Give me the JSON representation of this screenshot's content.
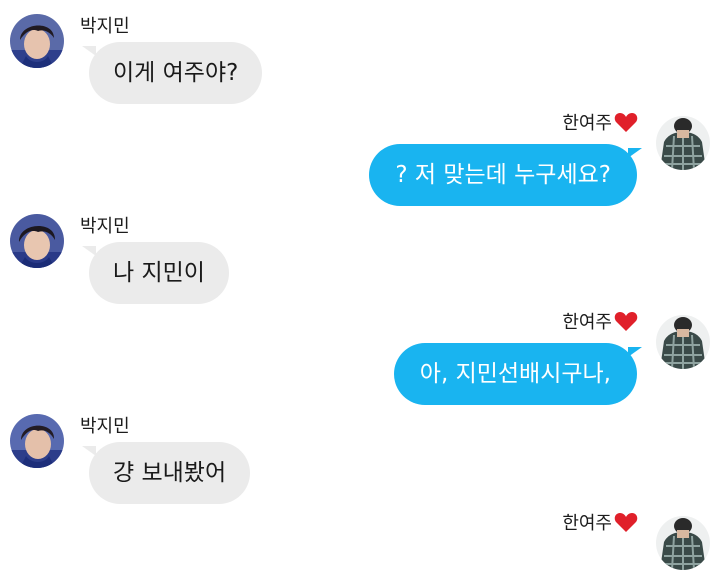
{
  "participants": {
    "them": {
      "name": "박지민",
      "avatar_icon": "profile-photo-jimin"
    },
    "me": {
      "name": "한여주",
      "name_icon": "red-heart-icon",
      "avatar_icon": "profile-photo-plaid-shirt"
    }
  },
  "colors": {
    "incoming_bubble": "#ebebeb",
    "outgoing_bubble": "#19b4f0",
    "heart": "#e0202a"
  },
  "messages": [
    {
      "sender": "박지민",
      "text": "이게 여주야?"
    },
    {
      "sender": "한여주",
      "text": "? 저 맞는데 누구세요?"
    },
    {
      "sender": "박지민",
      "text": "나 지민이"
    },
    {
      "sender": "한여주",
      "text": "아, 지민선배시구나,"
    },
    {
      "sender": "박지민",
      "text": "걍 보내봤어"
    },
    {
      "sender": "한여주",
      "text": ""
    }
  ]
}
